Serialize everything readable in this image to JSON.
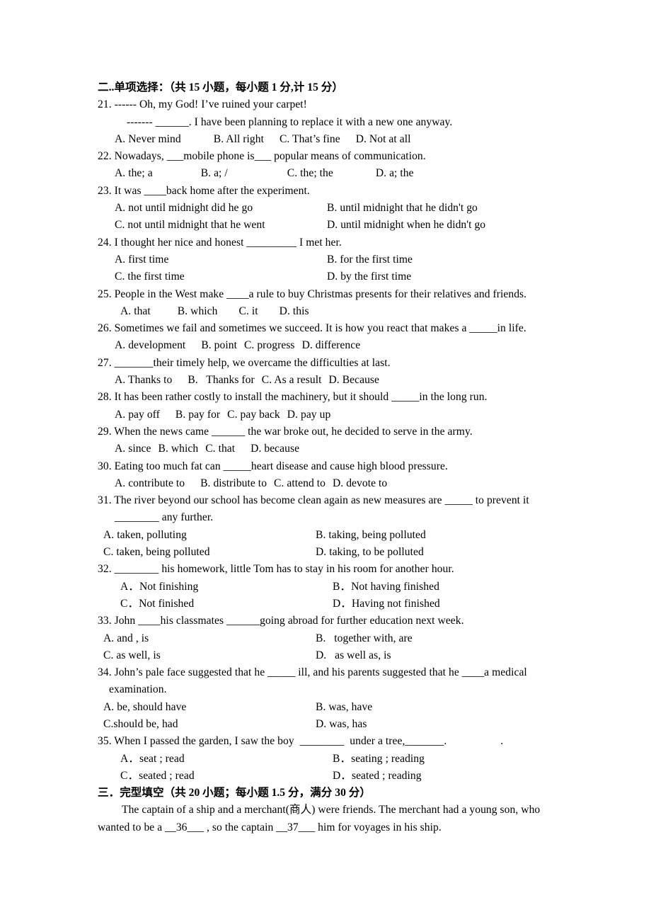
{
  "document": {
    "section2": {
      "heading": "二..单项选择：（共 15 小题，每小题 1 分,计 15 分）",
      "questions": [
        {
          "number": "21.",
          "stem_lines": [
            "21. ------ Oh, my God! I’ve ruined your carpet!",
            "------- ______. I have been planning to replace it with a new one anyway."
          ],
          "options_rows": [
            [
              "A. Never mind",
              "B. All right",
              "C. That’s fine",
              "D. Not at all"
            ]
          ]
        },
        {
          "number": "22.",
          "stem_lines": [
            "22. Nowadays, ___mobile phone is___ popular means of communication."
          ],
          "options_rows": [
            [
              "A. the; a",
              "B. a; /",
              "C. the; the",
              "D. a; the"
            ]
          ]
        },
        {
          "number": "23.",
          "stem_lines": [
            "23. It was ____back home after the experiment."
          ],
          "options_rows": [
            [
              "A. not until midnight did he go",
              "B. until midnight that he didn't go"
            ],
            [
              "C. not until midnight that he went",
              "D. until midnight when he didn't go"
            ]
          ]
        },
        {
          "number": "24.",
          "stem_lines": [
            "24. I thought her nice and honest _________ I met her."
          ],
          "options_rows": [
            [
              "A. first time",
              "B. for the first time"
            ],
            [
              "C. the first time",
              "D. by the first time"
            ]
          ]
        },
        {
          "number": "25.",
          "stem_lines": [
            "25. People in the West make ____a rule to buy Christmas presents for their relatives and friends."
          ],
          "options_rows": [
            [
              "A. that",
              "B. which",
              "C. it",
              "D. this"
            ]
          ]
        },
        {
          "number": "26.",
          "stem_lines": [
            "26. Sometimes we fail and sometimes we succeed. It is how you react that makes a _____in life."
          ],
          "options_rows": [
            [
              "A. development",
              "B. point",
              "C. progress",
              "D. difference"
            ]
          ]
        },
        {
          "number": "27.",
          "stem_lines": [
            "27. _______their timely help, we overcame the difficulties at last."
          ],
          "options_rows": [
            [
              "A. Thanks to",
              "B.   Thanks for",
              "C. As a result",
              "D. Because"
            ]
          ]
        },
        {
          "number": "28.",
          "stem_lines": [
            "28. It has been rather costly to install the machinery, but it should _____in the long run."
          ],
          "options_rows": [
            [
              "A. pay off",
              "B. pay for",
              "C. pay back",
              "D. pay up"
            ]
          ]
        },
        {
          "number": "29.",
          "stem_lines": [
            "29. When the news came ______ the war broke out, he decided to serve in the army."
          ],
          "options_rows": [
            [
              "A. since",
              "B. which",
              "C. that",
              "D. because"
            ]
          ]
        },
        {
          "number": "30.",
          "stem_lines": [
            "30. Eating too much fat can _____heart disease and cause high blood pressure."
          ],
          "options_rows": [
            [
              "A. contribute to",
              "B. distribute to",
              "C. attend to",
              "D. devote to"
            ]
          ]
        },
        {
          "number": "31.",
          "stem_lines": [
            "31. The river beyond our school has become clean again as new measures are _____ to prevent it",
            "________ any further."
          ],
          "options_rows": [
            [
              "A. taken, polluting",
              "B. taking, being polluted"
            ],
            [
              "C. taken, being polluted",
              "D. taking, to be polluted"
            ]
          ]
        },
        {
          "number": "32.",
          "stem_lines": [
            "32. ________ his homework, little Tom has to stay in his room for another hour."
          ],
          "options_rows": [
            [
              "A．Not finishing",
              "B．Not having finished"
            ],
            [
              "C．Not finished",
              "D．Having not finished"
            ]
          ]
        },
        {
          "number": "33.",
          "stem_lines": [
            "33. John ____his classmates ______going abroad for further education next week."
          ],
          "options_rows": [
            [
              "A. and , is",
              "B.   together with, are"
            ],
            [
              "C. as well, is",
              "D.   as well as, is"
            ]
          ]
        },
        {
          "number": "34.",
          "stem_lines": [
            "34. John’s pale face suggested that he _____ ill, and his parents suggested that he ____a medical",
            "examination."
          ],
          "options_rows": [
            [
              "A. be, should have",
              "B. was, have"
            ],
            [
              "C.should be, had",
              "D. was, has"
            ]
          ]
        },
        {
          "number": "35.",
          "stem_lines": [
            "35. When I passed the garden, I saw the boy  ________  under a tree,_______."
          ],
          "trailing_mark": ".",
          "options_rows": [
            [
              "A．seat ; read",
              "B．seating ; reading"
            ],
            [
              "C．seated ; read",
              "D．seated ; reading"
            ]
          ]
        }
      ]
    },
    "section3": {
      "heading": "三．完型填空（共 20 小题；每小题 1.5 分，满分 30 分）",
      "body_lines": [
        "The captain of a ship and a merchant(商人) were friends. The merchant had a young son, who",
        "wanted to be a __36___ , so the captain __37___ him for voyages in his ship."
      ]
    }
  }
}
